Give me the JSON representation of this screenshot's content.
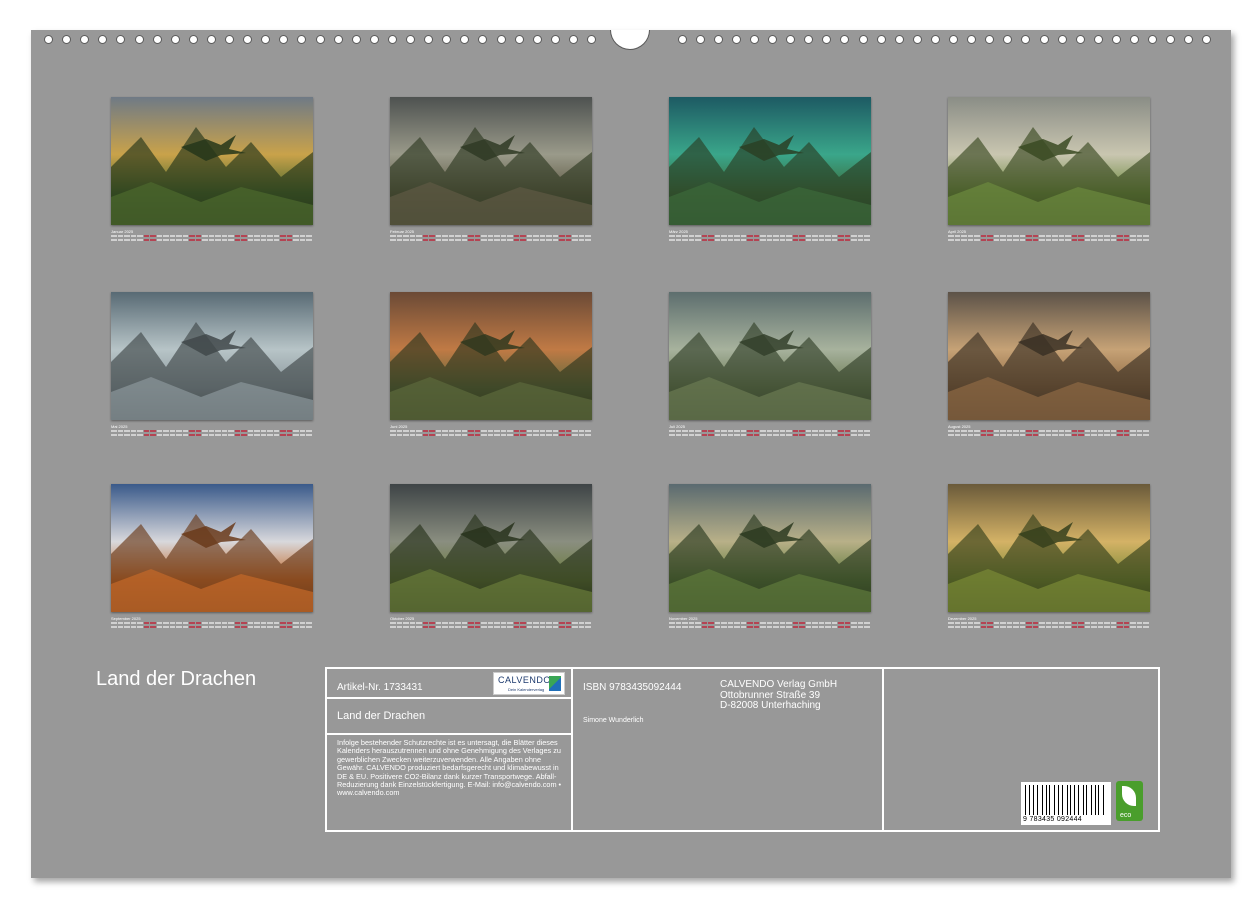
{
  "calendar_title": "Land der Drachen",
  "months": [
    {
      "name": "Januar 2025",
      "palette": [
        "#6f7a86",
        "#c9a24a",
        "#4d6a2e",
        "#25361a"
      ]
    },
    {
      "name": "Februar 2025",
      "palette": [
        "#4e5250",
        "#9a9a8a",
        "#5f5a44",
        "#2f3a24"
      ]
    },
    {
      "name": "März 2025",
      "palette": [
        "#1d5a63",
        "#3aa68a",
        "#3c6a3a",
        "#2a3f25"
      ]
    },
    {
      "name": "April 2025",
      "palette": [
        "#8a8d86",
        "#c9c6b0",
        "#6c8a3e",
        "#3a4a22"
      ]
    },
    {
      "name": "Mai 2025",
      "palette": [
        "#586a74",
        "#b7c4c7",
        "#8b979b",
        "#41484a"
      ]
    },
    {
      "name": "Juni 2025",
      "palette": [
        "#6b4a36",
        "#c07a45",
        "#5d6a3c",
        "#30381f"
      ]
    },
    {
      "name": "Juli 2025",
      "palette": [
        "#5d6e6e",
        "#a7b29d",
        "#6b7a52",
        "#33402a"
      ]
    },
    {
      "name": "August 2025",
      "palette": [
        "#5c5248",
        "#c6a276",
        "#8f6a44",
        "#3a3024"
      ]
    },
    {
      "name": "September 2025",
      "palette": [
        "#3a5a8a",
        "#d8d8dc",
        "#c46a2a",
        "#6a3a1a"
      ]
    },
    {
      "name": "Oktober 2025",
      "palette": [
        "#3e4446",
        "#8a8e80",
        "#6a7c3a",
        "#28331c"
      ]
    },
    {
      "name": "November 2025",
      "palette": [
        "#5a6a70",
        "#b8b088",
        "#5f7a3c",
        "#2b3a20"
      ]
    },
    {
      "name": "Dezember 2025",
      "palette": [
        "#6a5a3a",
        "#d4b266",
        "#7a8a36",
        "#35401c"
      ]
    }
  ],
  "info": {
    "article": "Artikel-Nr. 1733431",
    "logo_name": "CALVENDO",
    "logo_tag": "Dein Kalenderverlag",
    "book_title": "Land der Drachen",
    "legal": "Infolge bestehender Schutzrechte ist es untersagt, die Blätter dieses Kalenders herauszutrennen und ohne Genehmigung des Verlages zu gewerblichen Zwecken weiterzuverwenden. Alle Angaben ohne Gewähr. CALVENDO produziert bedarfsgerecht und klimabewusst in DE & EU. Positivere CO2-Bilanz dank kurzer Transportwege. Abfall-Reduzierung dank Einzelstückfertigung. E-Mail: info@calvendo.com • www.calvendo.com",
    "isbn": "ISBN 9783435092444",
    "author": "Simone Wunderlich",
    "publisher_name": "CALVENDO Verlag GmbH",
    "publisher_street": "Ottobrunner Straße 39",
    "publisher_city": "D-82008 Unterhaching",
    "barcode_number": "9 783435 092444",
    "eco_label": "eco"
  }
}
